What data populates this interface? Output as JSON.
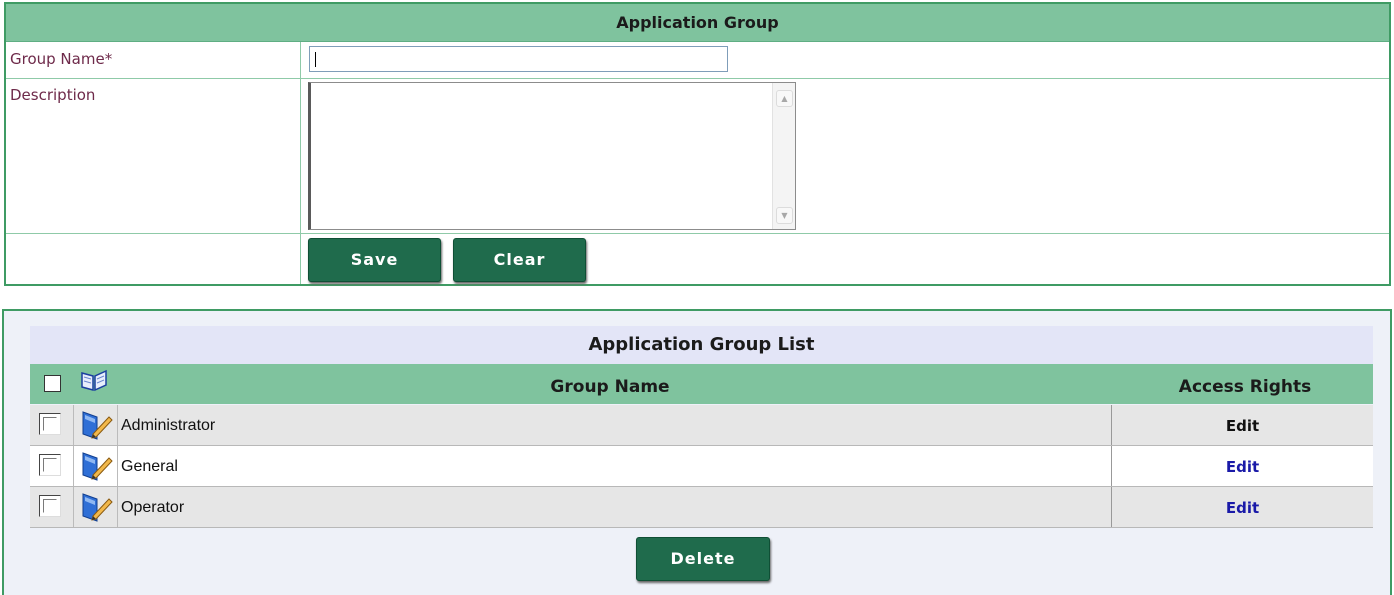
{
  "form": {
    "title": "Application Group",
    "group_name_label": "Group Name*",
    "group_name_value": "",
    "description_label": "Description",
    "description_value": "",
    "save_label": "Save",
    "clear_label": "Clear"
  },
  "list": {
    "title": "Application Group List",
    "column_group_name": "Group Name",
    "column_access_rights": "Access Rights",
    "rows": [
      {
        "name": "Administrator",
        "access_label": "Edit",
        "access_color": "#111111"
      },
      {
        "name": "General",
        "access_label": "Edit",
        "access_color": "#1a1aa8"
      },
      {
        "name": "Operator",
        "access_label": "Edit",
        "access_color": "#1a1aa8"
      }
    ],
    "delete_label": "Delete"
  },
  "colors": {
    "header_green": "#7fc39e",
    "button_green": "#1f6b4c",
    "border_green": "#3f9b64",
    "label_color": "#6e2a4a",
    "link_blue": "#1a1aa8"
  }
}
